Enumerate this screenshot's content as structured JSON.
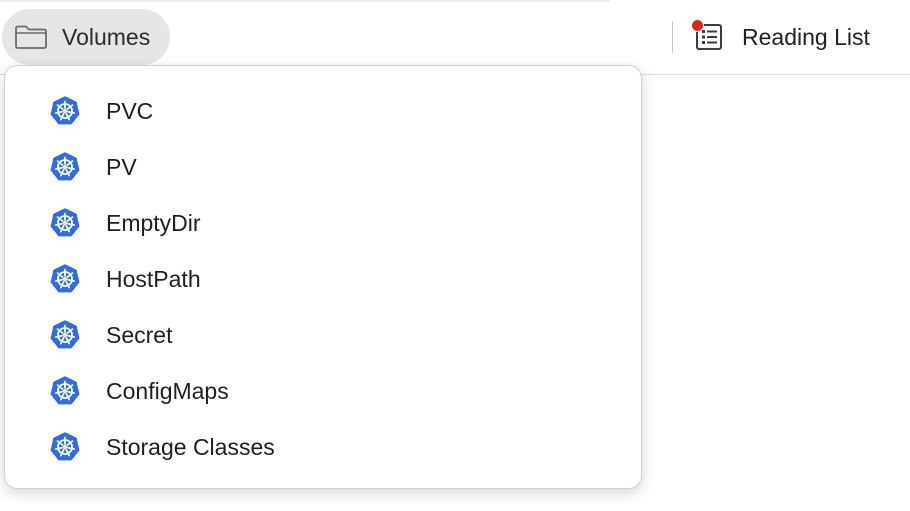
{
  "bookmarks_bar": {
    "folder": {
      "label": "Volumes",
      "icon": "folder-icon"
    },
    "reading_list": {
      "label": "Reading List",
      "icon": "reading-list-icon",
      "badge_color": "#e0251b"
    }
  },
  "dropdown": {
    "item_icon": "kubernetes-icon",
    "items": [
      {
        "label": "PVC"
      },
      {
        "label": "PV"
      },
      {
        "label": "EmptyDir"
      },
      {
        "label": "HostPath"
      },
      {
        "label": "Secret"
      },
      {
        "label": "ConfigMaps"
      },
      {
        "label": "Storage Classes"
      }
    ]
  },
  "colors": {
    "accent": "#326ce5",
    "chip_bg": "#e6e6e6"
  }
}
